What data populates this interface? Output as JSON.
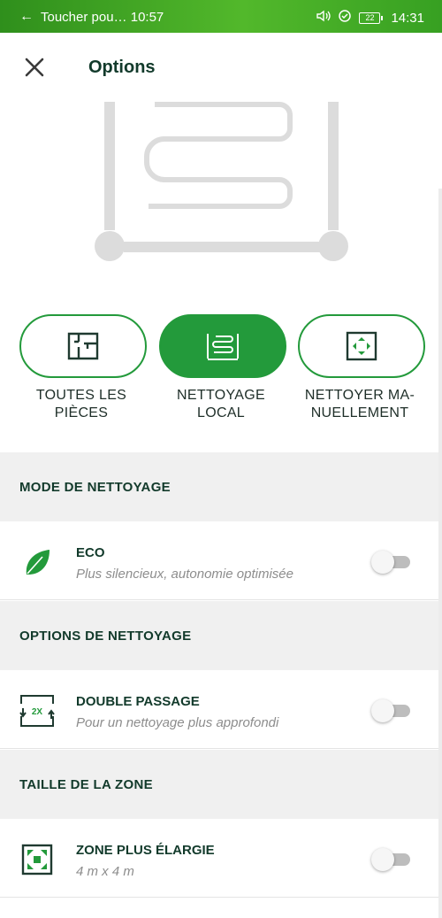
{
  "status": {
    "notification": "Toucher pou… 10:57",
    "battery": "22",
    "time": "14:31"
  },
  "header": {
    "title": "Options"
  },
  "modes": [
    {
      "label_line1": "TOUTES LES",
      "label_line2": "PIÈCES",
      "active": false
    },
    {
      "label_line1": "NETTOYAGE",
      "label_line2": "LOCAL",
      "active": true
    },
    {
      "label_line1": "NETTOYER MA-",
      "label_line2": "NUELLEMENT",
      "active": false
    }
  ],
  "sections": {
    "mode": {
      "title": "MODE DE NETTOYAGE",
      "item": {
        "title": "ECO",
        "subtitle": "Plus silencieux, autonomie optimisée",
        "enabled": false
      }
    },
    "options": {
      "title": "OPTIONS DE NETTOYAGE",
      "item": {
        "title": "DOUBLE PASSAGE",
        "subtitle": "Pour un nettoyage plus approfondi",
        "enabled": false,
        "badge": "2X"
      }
    },
    "zone": {
      "title": "TAILLE DE LA ZONE",
      "item": {
        "title": "ZONE PLUS ÉLARGIE",
        "subtitle": "4 m x 4 m",
        "enabled": false
      }
    }
  },
  "colors": {
    "accent": "#239a3b",
    "status_bar": "#3fa524",
    "text_dark": "#123a2b",
    "section_bg": "#f0f0f0"
  }
}
